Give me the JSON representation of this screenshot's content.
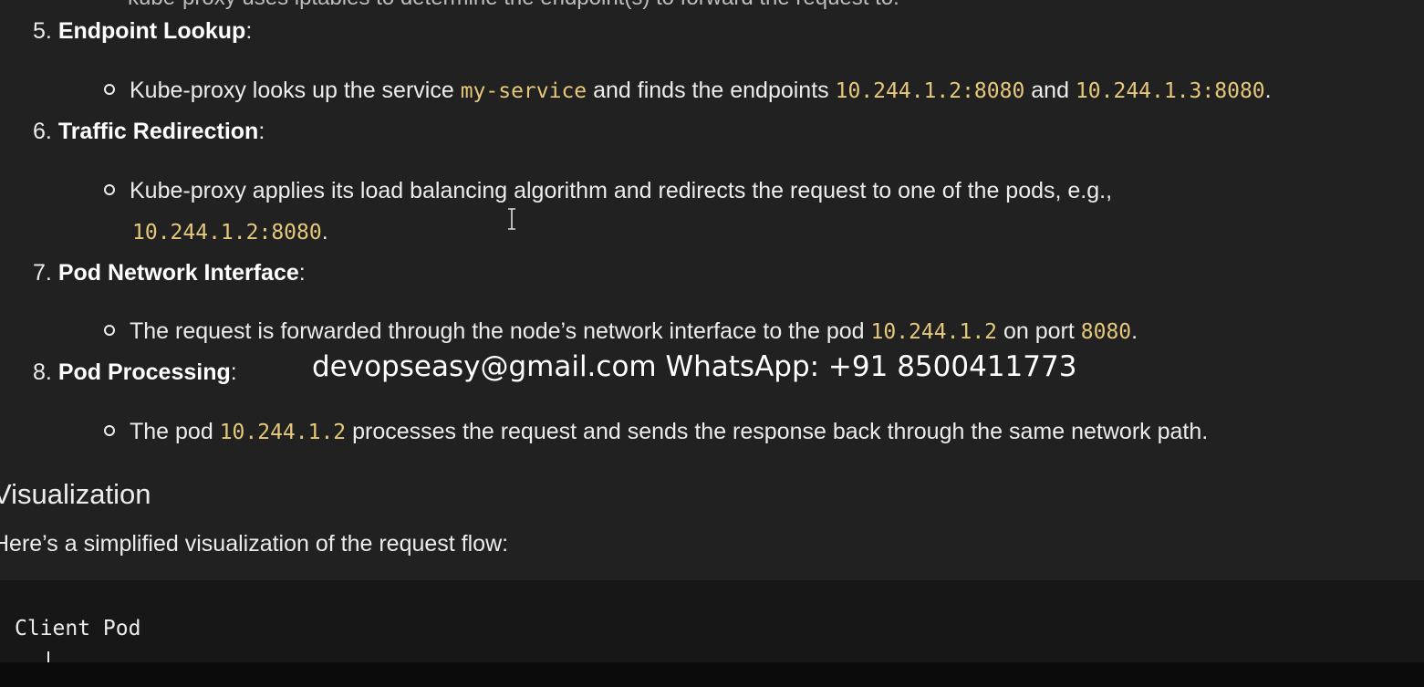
{
  "cutoff_text": "kube-proxy uses iptables to determine the endpoint(s) to forward the request to.",
  "steps": [
    {
      "num": "5.",
      "title": "Endpoint Lookup",
      "suffix": ":",
      "bullet": {
        "t1": "Kube-proxy looks up the service ",
        "c1": "my-service",
        "t2": " and finds the endpoints ",
        "c2": "10.244.1.2:8080",
        "t3": " and ",
        "c3": "10.244.1.3:8080",
        "t4": "."
      }
    },
    {
      "num": "6.",
      "title": "Traffic Redirection",
      "suffix": ":",
      "bullet": {
        "t1": "Kube-proxy applies its load balancing algorithm and redirects the request to one of the pods, e.g.,",
        "c1": "10.244.1.2:8080",
        "t2": "."
      }
    },
    {
      "num": "7.",
      "title": "Pod Network Interface",
      "suffix": ":",
      "bullet": {
        "t1": "The request is forwarded through the node’s network interface to the pod ",
        "c1": "10.244.1.2",
        "t2": " on port ",
        "c2": "8080",
        "t3": "."
      }
    },
    {
      "num": "8.",
      "title": "Pod Processing",
      "suffix": ":",
      "bullet": {
        "t1": "The pod ",
        "c1": "10.244.1.2",
        "t2": " processes the request and sends the response back through the same network path."
      }
    }
  ],
  "watermark": "devopseasy@gmail.com WhatsApp: +91 8500411773",
  "section": {
    "heading": "Visualization",
    "intro": "Here’s a simplified visualization of the request flow:"
  },
  "code_block": {
    "line1": "Client Pod"
  },
  "colors": {
    "background": "#212121",
    "code_inline": "#e6c87a",
    "code_block_bg": "#171717"
  }
}
